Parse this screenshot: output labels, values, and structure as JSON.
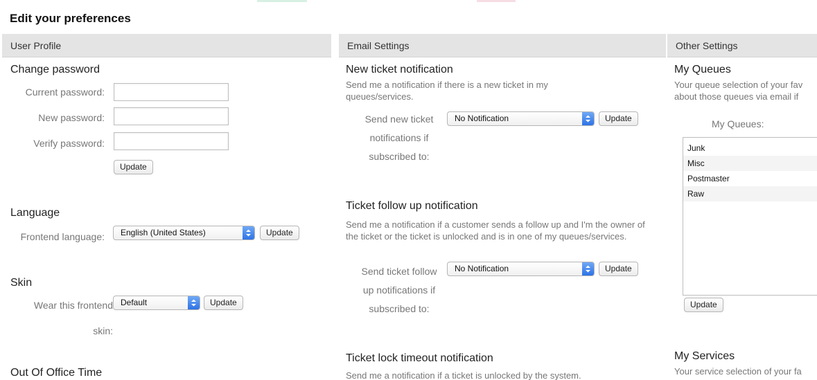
{
  "page": {
    "title": "Edit your preferences"
  },
  "columns": {
    "user_profile": {
      "header": "User Profile",
      "change_password": {
        "title": "Change password",
        "current_label": "Current password:",
        "new_label": "New password:",
        "verify_label": "Verify password:",
        "update_label": "Update"
      },
      "language": {
        "title": "Language",
        "label": "Frontend language:",
        "selected": "English (United States)",
        "update_label": "Update"
      },
      "skin": {
        "title": "Skin",
        "label_line1": "Wear this frontend",
        "label_line2": "skin:",
        "selected": "Default",
        "update_label": "Update"
      },
      "out_of_office": {
        "title": "Out Of Office Time"
      }
    },
    "email_settings": {
      "header": "Email Settings",
      "new_ticket": {
        "title": "New ticket notification",
        "description": "Send me a notification if there is a new ticket in my queues/services.",
        "label_line1": "Send new ticket",
        "label_line2": "notifications if",
        "label_line3": "subscribed to:",
        "selected": "No Notification",
        "update_label": "Update"
      },
      "follow_up": {
        "title": "Ticket follow up notification",
        "description": "Send me a notification if a customer sends a follow up and I'm the owner of the ticket or the ticket is unlocked and is in one of my queues/services.",
        "label_line1": "Send ticket follow",
        "label_line2": "up notifications if",
        "label_line3": "subscribed to:",
        "selected": "No Notification",
        "update_label": "Update"
      },
      "lock_timeout": {
        "title": "Ticket lock timeout notification",
        "description": "Send me a notification if a ticket is unlocked by the system."
      }
    },
    "other_settings": {
      "header": "Other Settings",
      "my_queues": {
        "title": "My Queues",
        "description": "Your queue selection of your fav about those queues via email if",
        "label": "My Queues:",
        "items": [
          "Junk",
          "Misc",
          "Postmaster",
          "Raw"
        ],
        "update_label": "Update"
      },
      "my_services": {
        "title": "My Services",
        "description": "Your service selection of your fa"
      }
    }
  },
  "colors": {
    "header_bg": "#e4e4e4",
    "select_arrow": "#3b82f6",
    "deco_green": "#d8f0e4",
    "deco_pink": "#f6dde4"
  }
}
